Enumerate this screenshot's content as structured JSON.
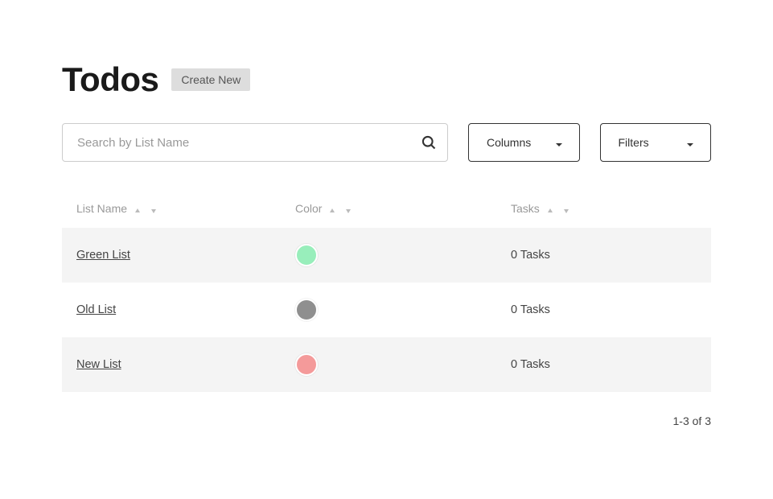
{
  "header": {
    "title": "Todos",
    "create_label": "Create New"
  },
  "controls": {
    "search_placeholder": "Search by List Name",
    "columns_label": "Columns",
    "filters_label": "Filters"
  },
  "table": {
    "headers": {
      "name": "List Name",
      "color": "Color",
      "tasks": "Tasks"
    },
    "rows": [
      {
        "name": "Green List",
        "color": "#98eebb",
        "tasks": "0 Tasks"
      },
      {
        "name": "Old List",
        "color": "#8f8f8f",
        "tasks": "0 Tasks"
      },
      {
        "name": "New List",
        "color": "#f49a9a",
        "tasks": "0 Tasks"
      }
    ]
  },
  "pagination": "1-3 of 3"
}
